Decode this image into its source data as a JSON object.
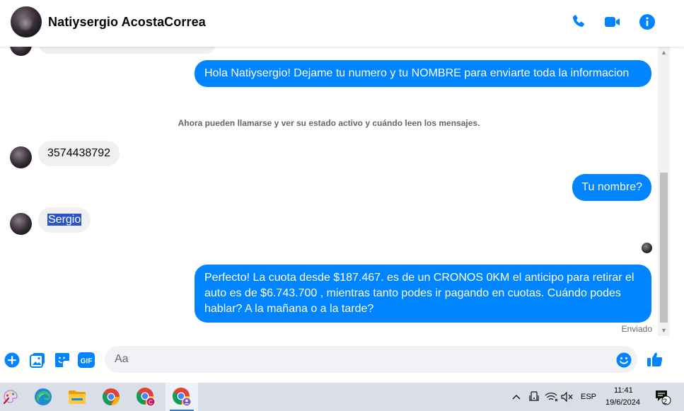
{
  "header": {
    "contact_name": "Natiysergio AcostaCorrea",
    "icons": [
      "phone-icon",
      "video-camera-icon",
      "info-icon"
    ],
    "accent_color": "#0084ff"
  },
  "messages": {
    "out_1": "Hola Natiysergio! Dejame tu numero y tu NOMBRE  para enviarte toda la informacion",
    "system_notice": "Ahora pueden llamarse y ver su estado activo y cuándo leen los mensajes.",
    "in_phone": "3574438792",
    "out_2": "Tu nombre?",
    "in_name": "Sergio",
    "out_3": "Perfecto! La cuota desde $187.467. es de un CRONOS 0KM el anticipo para retirar el auto es de $6.743.700 , mientras tanto podes ir pagando en cuotas. Cuándo podes hablar? A la mañana o a la tarde?",
    "status": "Enviado"
  },
  "composer": {
    "placeholder": "Aa",
    "icons": [
      "plus-circle-icon",
      "image-icon",
      "sticker-icon",
      "gif-icon",
      "emoji-icon",
      "thumbs-up-icon"
    ]
  },
  "taskbar": {
    "apps": [
      "paint-app-icon",
      "edge-icon",
      "file-explorer-icon",
      "chrome-icon",
      "chrome-profile-c-icon",
      "chrome-profile-active-icon"
    ],
    "language": "ESP",
    "time": "11:41",
    "date": "19/6/2024",
    "notifications_count": "2"
  }
}
